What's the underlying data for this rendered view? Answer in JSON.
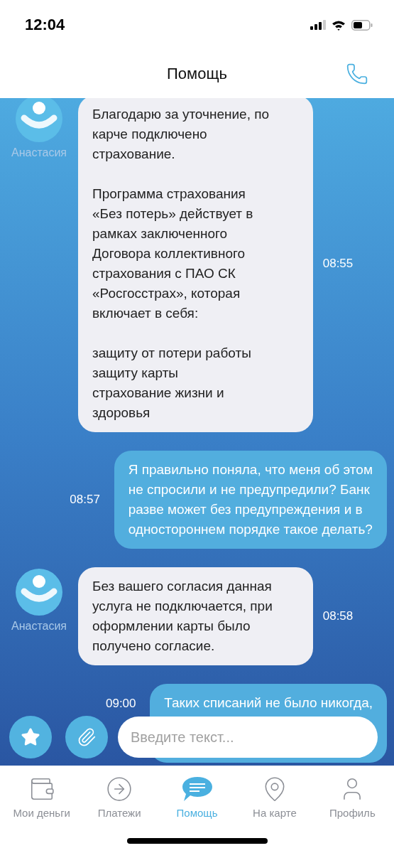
{
  "status_bar": {
    "time": "12:04"
  },
  "header": {
    "title": "Помощь"
  },
  "messages": [
    {
      "kind": "agent",
      "author": "Анастасия",
      "text": "Благодарю за уточнение, по\nкарче подключено\nстрахование.\n\nПрограмма страхования\n«Без потерь» действует в\nрамках заключенного\nДоговора коллективного\nстрахования с ПАО СК\n«Росгосстрах», которая\nвключает в себя:\n\nзащиту от потери работы\nзащиту карты\nстрахование жизни и\nздоровья",
      "time": "08:55"
    },
    {
      "kind": "user",
      "text": "Я правильно поняла, что меня об этом\nне спросили и не предупредили? Банк\nразве может без предупреждения и в\nодностороннем порядке такое делать?",
      "time": "08:57"
    },
    {
      "kind": "agent",
      "author": "Анастасия",
      "text": "Без вашего согласия данная\nуслуга не подключается, при\nоформлении карты было\nполучено согласие.",
      "time": "08:58"
    },
    {
      "kind": "user",
      "text": "Таких списаний не было никогда,",
      "time": "09:00"
    }
  ],
  "composer": {
    "placeholder": "Введите текст..."
  },
  "tabs": [
    {
      "label": "Мои деньги",
      "selected": false
    },
    {
      "label": "Платежи",
      "selected": false
    },
    {
      "label": "Помощь",
      "selected": true
    },
    {
      "label": "На карте",
      "selected": false
    },
    {
      "label": "Профиль",
      "selected": false
    }
  ]
}
